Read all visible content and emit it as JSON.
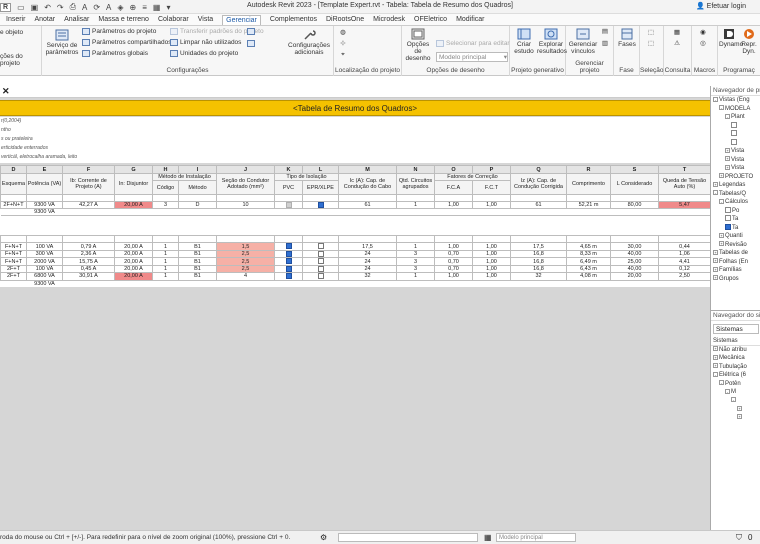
{
  "window": {
    "title": "Autodesk Revit 2023 - [Template Expert.rvt - Tabela: Tabela de Resumo dos Quadros]",
    "user": "Efetuar login"
  },
  "menu_tabs": [
    "Inserir",
    "Anotar",
    "Analisar",
    "Massa e terreno",
    "Colaborar",
    "Vista",
    "Gerenciar",
    "Complementos",
    "DiRootsOne",
    "Microdesk",
    "OFEletrico",
    "Modificar"
  ],
  "active_tab": "Gerenciar",
  "ribbon": {
    "btn_object_styles": "e objeto",
    "btn_project_locations": "ções do projeto",
    "btn_service_params": "Serviço de parâmetros",
    "row_project_params": "Parâmetros do projeto",
    "row_shared_params": "Parâmetros compartilhados",
    "row_global_params": "Parâmetros globais",
    "row_transfer_standards": "Transferir padrões do projeto",
    "row_purge_unused": "Limpar não utilizados",
    "row_project_units": "Unidades do projeto",
    "btn_additional_settings": "Configurações adicionais",
    "btn_design_options": "Opções de desenho",
    "row_add_to_set": "Selecionar para editar",
    "design_option_value": "Modelo principal",
    "btn_create_study": "Criar estudo",
    "btn_explore_results": "Explorar resultados",
    "btn_manage_links": "Gerenciar vínculos",
    "btn_phases": "Fases",
    "btn_dynamo": "Dynamo",
    "btn_dynamo_player": "Repr. Dyn.",
    "group_settings": "Configurações",
    "group_project_location": "Localização do projeto",
    "group_design_options": "Opções de desenho",
    "group_generative": "Projeto generativo",
    "group_manage_project": "Gerenciar projeto",
    "group_phase": "Fase",
    "group_selection": "Seleção",
    "group_query": "Consulta",
    "group_macros": "Macros",
    "group_visual_prog": "Programaç"
  },
  "schedule": {
    "title": "<Tabela de Resumo dos Quadros>",
    "notes": [
      "r(0,2004)",
      "ntho",
      "s ou prateleira",
      "erticidade enterrados",
      "verticál, eletrocalha aramada, leito"
    ],
    "col_letters": [
      "D",
      "E",
      "F",
      "G",
      "H",
      "I",
      "J",
      "K",
      "L",
      "M",
      "N",
      "O",
      "P",
      "Q",
      "R",
      "S",
      "T"
    ],
    "headers": {
      "c_D": "Esquema",
      "c_E": "Potência (VA)",
      "c_F": "Ib: Corrente de Projeto (A)",
      "c_G": "In: Disjuntor",
      "group_metodo": "Método de Instalação",
      "c_H": "Código",
      "c_I": "Método",
      "c_J": "Seção do Condutor Adotado (mm²)",
      "group_isolacao": "Tipo de Isolação",
      "c_K": "PVC",
      "c_L": "EPR/XLPE",
      "c_M": "Ic (A): Cap. de Condução do Cabo",
      "c_N": "Qtd. Circuitos agrupados",
      "group_fatores": "Fatores de Correção",
      "c_O": "F.C.A",
      "c_P": "F.C.T",
      "c_Q": "Iz (A): Cap. de Condução Corrigida",
      "c_R": "Comprimento",
      "c_S": "L Considerado",
      "c_T": "Queda de Tensão Auto (%)"
    },
    "rows1": [
      {
        "D": "2F+N+T",
        "E": "9300 VA",
        "F": "42,27 A",
        "G": "20,00 A",
        "H": "3",
        "I": "D",
        "J": "10",
        "K": "off",
        "L": "on",
        "M": "61",
        "N": "1",
        "O": "1,00",
        "P": "1,00",
        "Q": "61",
        "R": "52,21 m",
        "S": "80,00",
        "T": "5,47"
      }
    ],
    "subtotal1": "9300 VA",
    "rows2": [
      {
        "D": "F+N+T",
        "E": "100 VA",
        "F": "0,79 A",
        "G": "20,00 A",
        "H": "1",
        "I": "B1",
        "J": "1,5",
        "K": "on",
        "L": "dis",
        "M": "17,5",
        "N": "1",
        "O": "1,00",
        "P": "1,00",
        "Q": "17,5",
        "R": "4,65 m",
        "S": "30,00",
        "T": "0,44"
      },
      {
        "D": "F+N+T",
        "E": "300 VA",
        "F": "2,36 A",
        "G": "20,00 A",
        "H": "1",
        "I": "B1",
        "J": "2,5",
        "K": "on",
        "L": "dis",
        "M": "24",
        "N": "3",
        "O": "0,70",
        "P": "1,00",
        "Q": "16,8",
        "R": "8,33 m",
        "S": "40,00",
        "T": "1,06"
      },
      {
        "D": "F+N+T",
        "E": "2000 VA",
        "F": "15,75 A",
        "G": "20,00 A",
        "H": "1",
        "I": "B1",
        "J": "2,5",
        "K": "on",
        "L": "dis",
        "M": "24",
        "N": "3",
        "O": "0,70",
        "P": "1,00",
        "Q": "16,8",
        "R": "6,49 m",
        "S": "25,00",
        "T": "4,41"
      },
      {
        "D": "2F+T",
        "E": "100 VA",
        "F": "0,45 A",
        "G": "20,00 A",
        "H": "1",
        "I": "B1",
        "J": "2,5",
        "K": "on",
        "L": "dis",
        "M": "24",
        "N": "3",
        "O": "0,70",
        "P": "1,00",
        "Q": "16,8",
        "R": "6,43 m",
        "S": "40,00",
        "T": "0,12"
      },
      {
        "D": "2F+T",
        "E": "6800 VA",
        "F": "30,91 A",
        "G": "20,00 A",
        "H": "1",
        "I": "B1",
        "J": "4",
        "K": "on",
        "L": "dis",
        "M": "32",
        "N": "1",
        "O": "1,00",
        "P": "1,00",
        "Q": "32",
        "R": "4,08 m",
        "S": "20,00",
        "T": "2,50"
      }
    ],
    "subtotal2": "9300 VA"
  },
  "project_browser": {
    "title": "Navegador de pr",
    "items": [
      {
        "label": "Vistas (Eng",
        "lvl": 0,
        "exp": "-"
      },
      {
        "label": "MODELA",
        "lvl": 1,
        "exp": "-"
      },
      {
        "label": "Plant",
        "lvl": 2,
        "exp": "-"
      },
      {
        "label": "",
        "lvl": 3,
        "box": true
      },
      {
        "label": "",
        "lvl": 3,
        "box": true
      },
      {
        "label": "",
        "lvl": 3,
        "box": true
      },
      {
        "label": "Vista",
        "lvl": 2,
        "exp": "+"
      },
      {
        "label": "Vista",
        "lvl": 2,
        "exp": "+"
      },
      {
        "label": "Vista",
        "lvl": 2,
        "exp": "+"
      },
      {
        "label": "PROJETO",
        "lvl": 1,
        "exp": "+"
      },
      {
        "label": "Legendas",
        "lvl": 0,
        "exp": "+"
      },
      {
        "label": "Tabelas/Q",
        "lvl": 0,
        "exp": "-"
      },
      {
        "label": "Cálculos",
        "lvl": 1,
        "exp": "-"
      },
      {
        "label": "Po",
        "lvl": 2,
        "box": true
      },
      {
        "label": "Ta",
        "lvl": 2,
        "box": true
      },
      {
        "label": "Ta",
        "lvl": 2,
        "box": true,
        "sel": true
      },
      {
        "label": "Quanti",
        "lvl": 1,
        "exp": "+"
      },
      {
        "label": "Revisão",
        "lvl": 1,
        "exp": "+"
      },
      {
        "label": "Tabelas de",
        "lvl": 0,
        "exp": "+"
      },
      {
        "label": "Folhas (En",
        "lvl": 0,
        "exp": "+"
      },
      {
        "label": "Famílias",
        "lvl": 0,
        "exp": "+"
      },
      {
        "label": "Grupos",
        "lvl": 0,
        "exp": "+"
      }
    ]
  },
  "system_browser": {
    "title": "Navegador do sis",
    "dropdown": "Sistemas",
    "section": "Sistemas",
    "items": [
      {
        "label": "Não atribu",
        "lvl": 0,
        "exp": "+"
      },
      {
        "label": "Mecânica",
        "lvl": 0,
        "exp": "+"
      },
      {
        "label": "Tubulação",
        "lvl": 0,
        "exp": "+"
      },
      {
        "label": "Elétrica (6",
        "lvl": 0,
        "exp": "-"
      },
      {
        "label": "Potên",
        "lvl": 1,
        "exp": "-"
      },
      {
        "label": "M",
        "lvl": 2,
        "exp": "-"
      },
      {
        "label": "",
        "lvl": 3,
        "exp": "-"
      },
      {
        "label": "",
        "lvl": 4,
        "exp": "+"
      },
      {
        "label": "",
        "lvl": 4,
        "exp": "+"
      }
    ]
  },
  "status": {
    "message": "roda do mouse ou Ctrl + [+/-]. Para redefinir para o nível de zoom original (100%), pressione Ctrl + 0.",
    "model": "Modelo principal"
  }
}
